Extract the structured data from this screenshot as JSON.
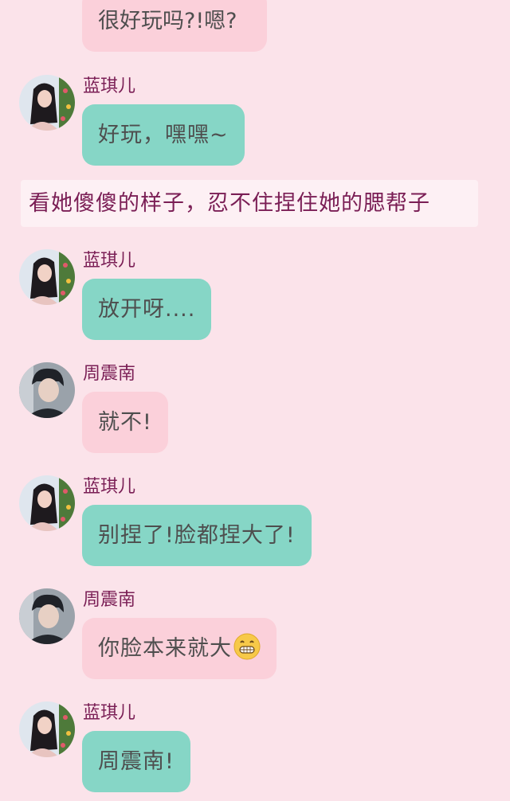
{
  "partial_top_message": {
    "text": "很好玩吗?!嗯?"
  },
  "narration": "看她傻傻的样子，忍不住捏住她的腮帮子",
  "messages": [
    {
      "sender": "蓝琪儿",
      "side": "her",
      "text": "好玩，嘿嘿~"
    },
    {
      "sender": "蓝琪儿",
      "side": "her",
      "text": "放开呀...."
    },
    {
      "sender": "周震南",
      "side": "him",
      "text": "就不!"
    },
    {
      "sender": "蓝琪儿",
      "side": "her",
      "text": "别捏了!脸都捏大了!"
    },
    {
      "sender": "周震南",
      "side": "him",
      "text": "你脸本来就大",
      "emoji": "grinning-face-emoji"
    },
    {
      "sender": "蓝琪儿",
      "side": "her",
      "text": "周震南!"
    }
  ],
  "colors": {
    "background": "#fbe3ea",
    "her_bubble": "#86d6c6",
    "him_bubble": "#fbd0da",
    "name_text": "#7a1e55",
    "narration_bg": "#fdf0f4"
  },
  "icons": {
    "her_avatar": "girl-avatar-photo",
    "him_avatar": "boy-avatar-photo"
  }
}
